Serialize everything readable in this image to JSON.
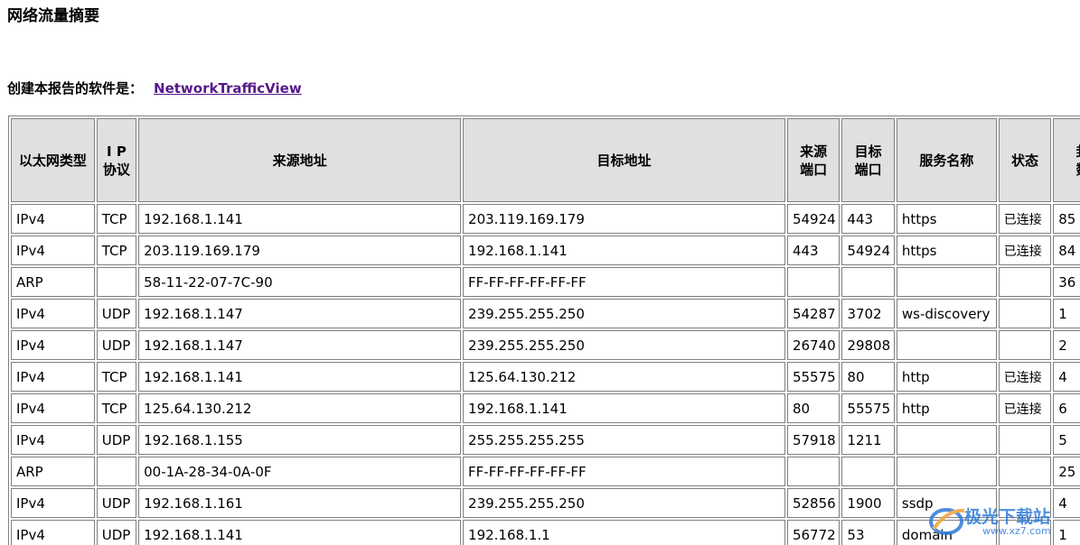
{
  "page": {
    "title": "网络流量摘要",
    "created_by_label": "创建本报告的软件是：",
    "created_by_link": "NetworkTrafficView"
  },
  "table": {
    "headers": [
      "以太网类型",
      "I P\n协议",
      "来源地址",
      "目标地址",
      "来源\n端口",
      "目标\n端口",
      "服务名称",
      "状态",
      "封包\n数量"
    ],
    "rows": [
      [
        "IPv4",
        "TCP",
        "192.168.1.141",
        "203.119.169.179",
        "54924",
        "443",
        "https",
        "已连接",
        "85"
      ],
      [
        "IPv4",
        "TCP",
        "203.119.169.179",
        "192.168.1.141",
        "443",
        "54924",
        "https",
        "已连接",
        "84"
      ],
      [
        "ARP",
        "",
        "58-11-22-07-7C-90",
        "FF-FF-FF-FF-FF-FF",
        "",
        "",
        "",
        "",
        "36"
      ],
      [
        "IPv4",
        "UDP",
        "192.168.1.147",
        "239.255.255.250",
        "54287",
        "3702",
        "ws-discovery",
        "",
        "1"
      ],
      [
        "IPv4",
        "UDP",
        "192.168.1.147",
        "239.255.255.250",
        "26740",
        "29808",
        "",
        "",
        "2"
      ],
      [
        "IPv4",
        "TCP",
        "192.168.1.141",
        "125.64.130.212",
        "55575",
        "80",
        "http",
        "已连接",
        "4"
      ],
      [
        "IPv4",
        "TCP",
        "125.64.130.212",
        "192.168.1.141",
        "80",
        "55575",
        "http",
        "已连接",
        "6"
      ],
      [
        "IPv4",
        "UDP",
        "192.168.1.155",
        "255.255.255.255",
        "57918",
        "1211",
        "",
        "",
        "5"
      ],
      [
        "ARP",
        "",
        "00-1A-28-34-0A-0F",
        "FF-FF-FF-FF-FF-FF",
        "",
        "",
        "",
        "",
        "25"
      ],
      [
        "IPv4",
        "UDP",
        "192.168.1.161",
        "239.255.255.250",
        "52856",
        "1900",
        "ssdp",
        "",
        "4"
      ],
      [
        "IPv4",
        "UDP",
        "192.168.1.141",
        "192.168.1.1",
        "56772",
        "53",
        "domain",
        "",
        "1"
      ]
    ]
  },
  "watermark": {
    "title": "极光下载站",
    "url": "www.xz7.com",
    "icon": "aurora-logo-icon"
  },
  "colors": {
    "header_bg": "#e0e0e0",
    "border": "#808080",
    "link": "#551a8b",
    "watermark": "#2f7bd9"
  }
}
